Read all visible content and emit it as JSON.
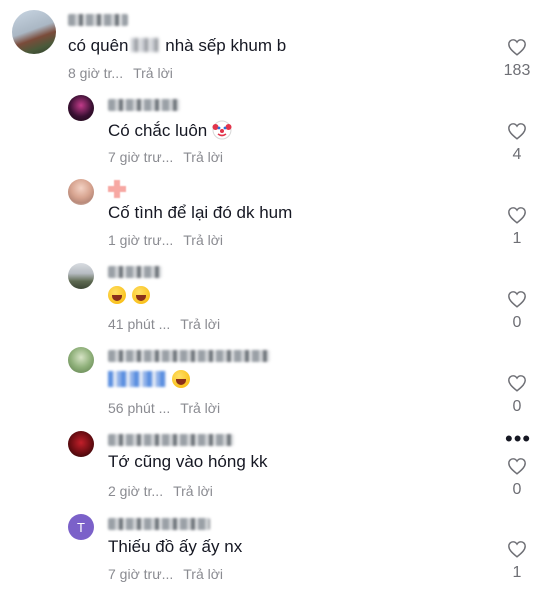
{
  "actions": {
    "reply_label": "Trả lời"
  },
  "comments": [
    {
      "text": "có quên",
      "text_tail": "nhà sếp khum b",
      "time": "8 giờ tr...",
      "likes": "183"
    },
    {
      "text": "Có chắc luôn",
      "emoji_icon": "clown-face-icon",
      "time": "7 giờ trư...",
      "likes": "4"
    },
    {
      "text": "Cố tình để lại đó dk hum",
      "time": "1 giờ trư...",
      "likes": "1"
    },
    {
      "emojis": [
        "laughing-face-icon",
        "laughing-face-icon"
      ],
      "time": "41 phút ...",
      "likes": "0"
    },
    {
      "emojis": [
        "joy-face-icon"
      ],
      "time": "56 phút ...",
      "likes": "0"
    },
    {
      "text": "Tớ cũng vào hóng kk",
      "time": "2 giờ tr...",
      "likes": "0"
    },
    {
      "avatar_letter": "T",
      "text": "Thiếu đồ ấy ấy nx",
      "time": "7 giờ trư...",
      "likes": "1"
    }
  ],
  "more_menu_icon": "more-horizontal-icon",
  "colors": {
    "avatar_purple": "#7b61c9",
    "meta_gray": "#8a8b91",
    "like_outline": "#6e6f75"
  }
}
